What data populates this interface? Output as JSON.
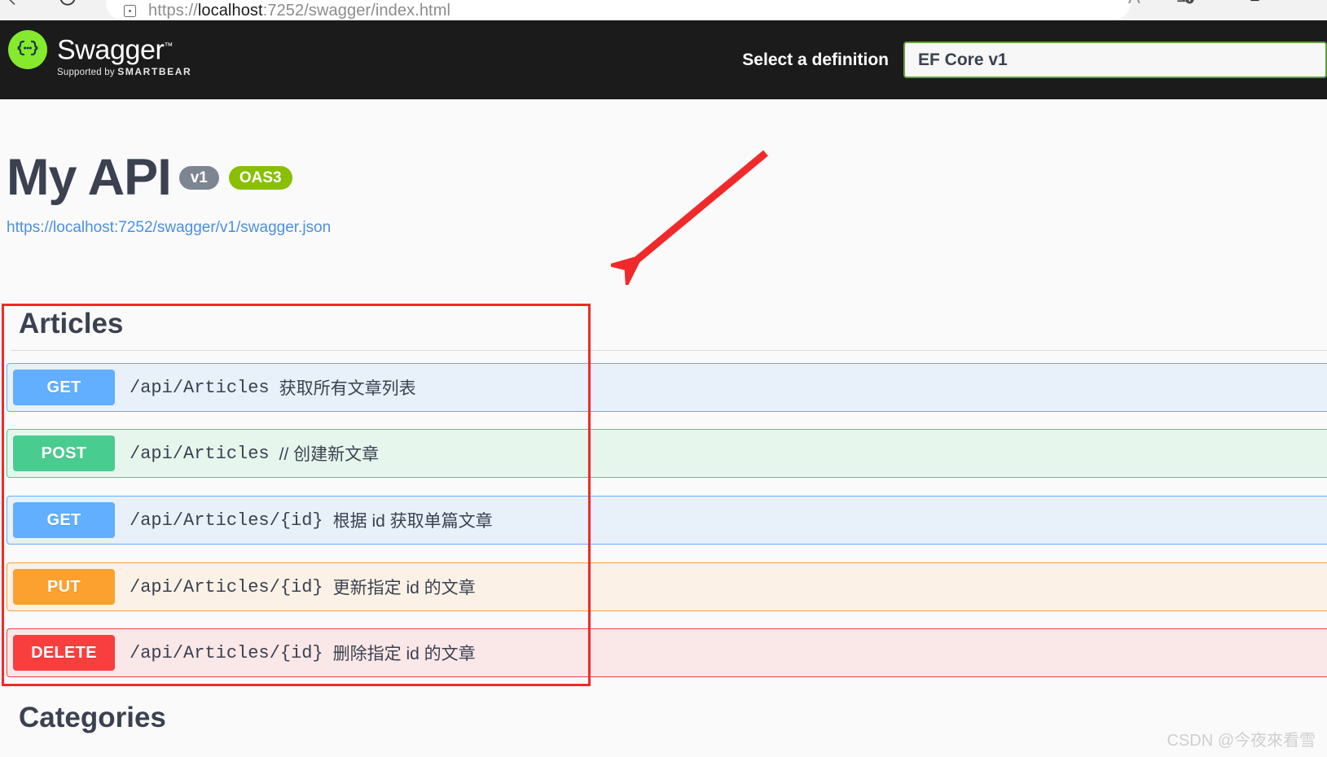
{
  "browser": {
    "url_prefix": "https://",
    "url_host": "localhost",
    "url_rest": ":7252/swagger/index.html",
    "back_icon": "back-arrow-icon",
    "reload_icon": "reload-icon",
    "site_info_icon": "site-info-icon",
    "read_aloud_icon": "read-aloud-icon",
    "collections_icon": "collections-add-icon",
    "favorites_icon": "favorites-icon"
  },
  "topbar": {
    "logo_word": "Swagger",
    "logo_tm": "™",
    "supported_by": "Supported by",
    "brand": "SMARTBEAR",
    "definition_label": "Select a definition",
    "definition_value": "EF  Core v1",
    "definition_border_color": "#62a03f",
    "background": "#1b1b1b",
    "logo_green": "#85ea2d"
  },
  "info": {
    "title": "My API",
    "version_badge": "v1",
    "oas_badge": "OAS3",
    "spec_url": "https://localhost:7252/swagger/v1/swagger.json",
    "version_badge_color": "#7d8492",
    "oas_badge_color": "#89bf04",
    "link_color": "#4a90e2"
  },
  "tags": [
    {
      "name": "Articles",
      "operations": [
        {
          "method": "GET",
          "path": "/api/Articles",
          "summary": "获取所有文章列表",
          "color": "#61affe"
        },
        {
          "method": "POST",
          "path": "/api/Articles",
          "summary": "// 创建新文章",
          "color": "#49cc90"
        },
        {
          "method": "GET",
          "path": "/api/Articles/{id}",
          "summary": "根据 id 获取单篇文章",
          "color": "#61affe"
        },
        {
          "method": "PUT",
          "path": "/api/Articles/{id}",
          "summary": "更新指定 id 的文章",
          "color": "#fca130"
        },
        {
          "method": "DELETE",
          "path": "/api/Articles/{id}",
          "summary": "删除指定 id 的文章",
          "color": "#f93e3e"
        }
      ]
    },
    {
      "name": "Categories",
      "operations": []
    }
  ],
  "annotations": {
    "highlight_color": "#f02a2a",
    "arrow_color": "#f02a2a",
    "arrow_name": "red-annotation-arrow",
    "box_name": "red-annotation-box"
  },
  "watermark": "CSDN @今夜來看雪"
}
